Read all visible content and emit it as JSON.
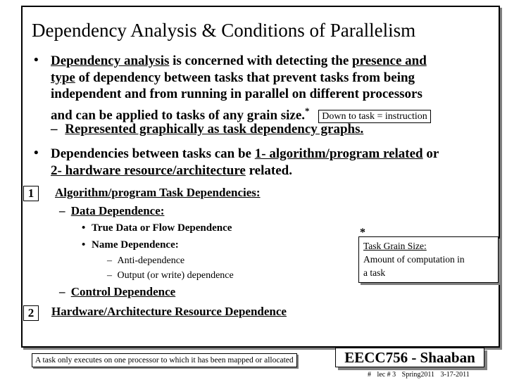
{
  "slide": {
    "title": "Dependency Analysis & Conditions of Parallelism",
    "bullet_glyph": "•",
    "dash_glyph": "–",
    "bullet1": {
      "line1_pre": "Dependency analysis",
      "line1_mid": " is concerned with detecting the ",
      "line1_post": "presence and",
      "line2_pre": "type",
      "line2_post": " of dependency between tasks that prevent tasks from being",
      "line3": "independent and from running in parallel on different processors",
      "line4": "and can be applied to tasks of any grain size.",
      "line4_star": "*",
      "boxed_note": "Down to task = instruction",
      "sub": "Represented graphically as task dependency graphs."
    },
    "bullet2": {
      "line1_pre": "Dependencies between tasks can be ",
      "line1_link": "1- algorithm/program related",
      "line1_post": " or",
      "line2_link": "2- hardware resource/architecture",
      "line2_post": " related."
    },
    "section1": {
      "number": "1",
      "heading": "Algorithm/program Task Dependencies:",
      "data_dependence": "Data Dependence:",
      "items": [
        "True Data or Flow Dependence",
        "Name Dependence:"
      ],
      "name_sub_items": [
        "Anti-dependence",
        "Output (or write) dependence"
      ],
      "control_dependence": "Control Dependence"
    },
    "section2": {
      "number": "2",
      "heading": "Hardware/Architecture Resource Dependence"
    },
    "grain_note": {
      "star": "*",
      "title": "Task Grain Size:",
      "line1": "Amount of computation in",
      "line2": "a task"
    },
    "footnote": "A task only executes on one processor to which it has been mapped or allocated",
    "brand": "EECC756 - Shaaban",
    "footer": {
      "hash": "#",
      "lecture": "lec # 3",
      "term": "Spring2011",
      "date": "3-17-2011"
    }
  }
}
